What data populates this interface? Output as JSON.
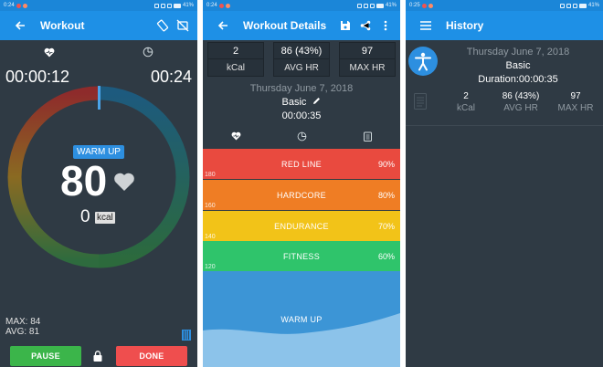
{
  "status": {
    "time_1": "0:24",
    "time_2": "0:24",
    "time_3": "0:25",
    "battery_1": "41%",
    "battery_2": "41%",
    "battery_3": "41%"
  },
  "workout": {
    "title": "Workout",
    "elapsed_left": "00:00:12",
    "elapsed_right": "00:24",
    "zone_label": "WARM UP",
    "heart_rate": "80",
    "kcal_value": "0",
    "kcal_unit": "kcal",
    "max_label": "MAX: 84",
    "avg_label": "AVG: 81",
    "pause_label": "PAUSE",
    "done_label": "DONE",
    "colors": {
      "pause": "#3bb54a",
      "done": "#ef4e4e"
    }
  },
  "details": {
    "title": "Workout Details",
    "stats": [
      {
        "value": "2",
        "label": "kCal"
      },
      {
        "value": "86 (43%)",
        "label": "AVG HR"
      },
      {
        "value": "97",
        "label": "MAX HR"
      }
    ],
    "date": "Thursday June 7, 2018",
    "name": "Basic",
    "duration": "00:00:35",
    "zones": [
      {
        "name": "RED LINE",
        "percent": "90%",
        "min": "180",
        "color": "#e94a3f"
      },
      {
        "name": "HARDCORE",
        "percent": "80%",
        "min": "160",
        "color": "#ef7d24"
      },
      {
        "name": "ENDURANCE",
        "percent": "70%",
        "min": "140",
        "color": "#f2c318"
      },
      {
        "name": "FITNESS",
        "percent": "60%",
        "min": "120",
        "color": "#2fc46b"
      }
    ],
    "warmup_label": "WARM UP",
    "warmup_color": "#3c95d6"
  },
  "history": {
    "title": "History",
    "date": "Thursday June 7, 2018",
    "name": "Basic",
    "duration": "Duration:00:00:35",
    "stats": [
      {
        "value": "2",
        "label": "kCal"
      },
      {
        "value": "86 (43%)",
        "label": "AVG HR"
      },
      {
        "value": "97",
        "label": "MAX HR"
      }
    ]
  },
  "icons": [
    "back-arrow-icon",
    "screen-rotation-icon",
    "no-sim-icon",
    "heart-pulse-icon",
    "pie-clock-icon",
    "save-icon",
    "share-icon",
    "more-vert-icon",
    "clipboard-icon",
    "lock-icon",
    "list-icon",
    "menu-icon",
    "accessibility-icon",
    "document-icon",
    "pencil-icon"
  ]
}
